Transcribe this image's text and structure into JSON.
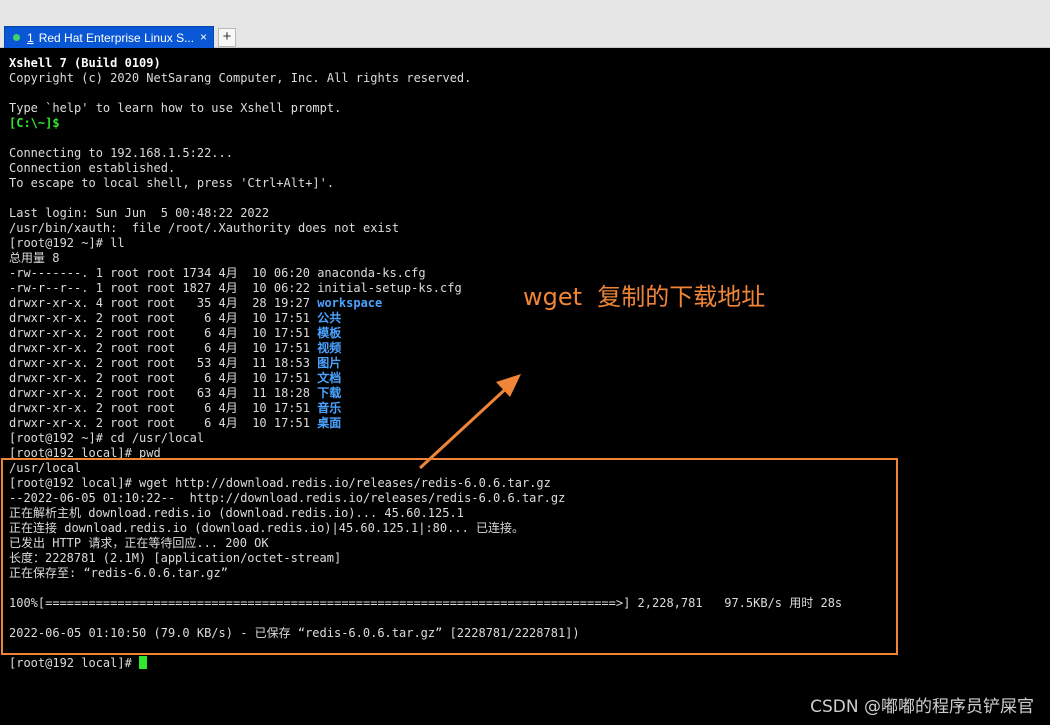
{
  "tabbar": {
    "tab": {
      "number": "1",
      "title": "Red Hat Enterprise Linux S...",
      "close_glyph": "×"
    },
    "new_tab_glyph": "+"
  },
  "terminal": {
    "lines": [
      [
        {
          "t": "Xshell 7 (Build 0109)",
          "s": "bold"
        }
      ],
      [
        {
          "t": "Copyright (c) 2020 NetSarang Computer, Inc. All rights reserved."
        }
      ],
      [
        {
          "t": ""
        }
      ],
      [
        {
          "t": "Type `help' to learn how to use Xshell prompt."
        }
      ],
      [
        {
          "t": "[C:\\~]$",
          "s": "green"
        }
      ],
      [
        {
          "t": ""
        }
      ],
      [
        {
          "t": "Connecting to 192.168.1.5:22..."
        }
      ],
      [
        {
          "t": "Connection established."
        }
      ],
      [
        {
          "t": "To escape to local shell, press 'Ctrl+Alt+]'."
        }
      ],
      [
        {
          "t": ""
        }
      ],
      [
        {
          "t": "Last login: Sun Jun  5 00:48:22 2022"
        }
      ],
      [
        {
          "t": "/usr/bin/xauth:  file /root/.Xauthority does not exist"
        }
      ],
      [
        {
          "t": "[root@192 ~]# ll"
        }
      ],
      [
        {
          "t": "总用量 8"
        }
      ],
      [
        {
          "t": "-rw-------. 1 root root 1734 4月  10 06:20 anaconda-ks.cfg"
        }
      ],
      [
        {
          "t": "-rw-r--r--. 1 root root 1827 4月  10 06:22 initial-setup-ks.cfg"
        }
      ],
      [
        {
          "t": "drwxr-xr-x. 4 root root   35 4月  28 19:27 "
        },
        {
          "t": "workspace",
          "s": "blue"
        }
      ],
      [
        {
          "t": "drwxr-xr-x. 2 root root    6 4月  10 17:51 "
        },
        {
          "t": "公共",
          "s": "blue"
        }
      ],
      [
        {
          "t": "drwxr-xr-x. 2 root root    6 4月  10 17:51 "
        },
        {
          "t": "模板",
          "s": "blue"
        }
      ],
      [
        {
          "t": "drwxr-xr-x. 2 root root    6 4月  10 17:51 "
        },
        {
          "t": "视频",
          "s": "blue"
        }
      ],
      [
        {
          "t": "drwxr-xr-x. 2 root root   53 4月  11 18:53 "
        },
        {
          "t": "图片",
          "s": "blue"
        }
      ],
      [
        {
          "t": "drwxr-xr-x. 2 root root    6 4月  10 17:51 "
        },
        {
          "t": "文档",
          "s": "blue"
        }
      ],
      [
        {
          "t": "drwxr-xr-x. 2 root root   63 4月  11 18:28 "
        },
        {
          "t": "下载",
          "s": "blue"
        }
      ],
      [
        {
          "t": "drwxr-xr-x. 2 root root    6 4月  10 17:51 "
        },
        {
          "t": "音乐",
          "s": "blue"
        }
      ],
      [
        {
          "t": "drwxr-xr-x. 2 root root    6 4月  10 17:51 "
        },
        {
          "t": "桌面",
          "s": "blue"
        }
      ],
      [
        {
          "t": "[root@192 ~]# cd /usr/local"
        }
      ],
      [
        {
          "t": "[root@192 local]# pwd"
        }
      ],
      [
        {
          "t": "/usr/local"
        }
      ],
      [
        {
          "t": "[root@192 local]# wget http://download.redis.io/releases/redis-6.0.6.tar.gz"
        }
      ],
      [
        {
          "t": "--2022-06-05 01:10:22--  http://download.redis.io/releases/redis-6.0.6.tar.gz"
        }
      ],
      [
        {
          "t": "正在解析主机 download.redis.io (download.redis.io)... 45.60.125.1"
        }
      ],
      [
        {
          "t": "正在连接 download.redis.io (download.redis.io)|45.60.125.1|:80... 已连接。"
        }
      ],
      [
        {
          "t": "已发出 HTTP 请求，正在等待回应... 200 OK"
        }
      ],
      [
        {
          "t": "长度：2228781 (2.1M) [application/octet-stream]"
        }
      ],
      [
        {
          "t": "正在保存至: “redis-6.0.6.tar.gz”"
        }
      ],
      [
        {
          "t": ""
        }
      ],
      [
        {
          "t": "100%[===============================================================================>] 2,228,781   97.5KB/s 用时 28s"
        }
      ],
      [
        {
          "t": ""
        }
      ],
      [
        {
          "t": "2022-06-05 01:10:50 (79.0 KB/s) - 已保存 “redis-6.0.6.tar.gz” [2228781/2228781])"
        }
      ],
      [
        {
          "t": ""
        }
      ],
      [
        {
          "t": "[root@192 local]# "
        },
        {
          "t": "",
          "s": "cursor"
        }
      ]
    ]
  },
  "annotation": {
    "text": "wget  复制的下载地址",
    "color": "#f08437"
  },
  "watermark": "CSDN @嘟嘟的程序员铲屎官",
  "colors": {
    "prompt_green": "#2fe72f",
    "dir_blue": "#4aa3ff",
    "tab_blue": "#0a57d6",
    "highlight_orange": "#f08437"
  }
}
